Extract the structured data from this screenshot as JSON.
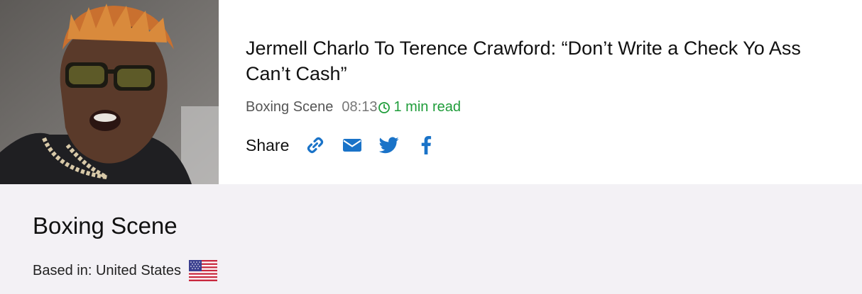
{
  "article": {
    "title": "Jermell Charlo To Terence Crawford: “Don’t Write a Check Yo Ass Can’t Cash”",
    "source": "Boxing Scene",
    "time": "08:13",
    "read_time": "1 min read",
    "thumbnail_icon": "boxer-portrait-image"
  },
  "share": {
    "label": "Share",
    "buttons": [
      {
        "icon": "link-icon"
      },
      {
        "icon": "envelope-icon"
      },
      {
        "icon": "twitter-icon"
      },
      {
        "icon": "facebook-icon"
      }
    ]
  },
  "source_panel": {
    "name": "Boxing Scene",
    "based_in": "Based in: United States",
    "flag_icon": "us-flag-icon"
  },
  "colors": {
    "accent_blue": "#1a73c8",
    "read_time_green": "#1f9d3a",
    "panel_bg": "#f3f1f5"
  }
}
